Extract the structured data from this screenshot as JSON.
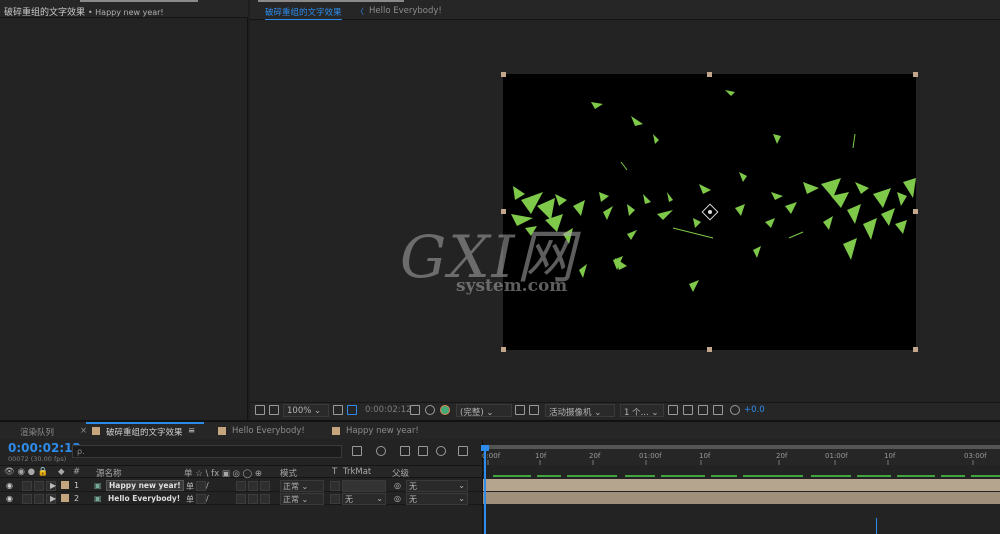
{
  "project_panel": {
    "tab_title": "破碎重组的文字效果",
    "tab_subtitle": "• Happy new year!"
  },
  "viewer": {
    "tabs": [
      "破碎重组的文字效果",
      "Hello Everybody!"
    ],
    "lock_glyph": "〈",
    "watermark_big": "GXI网",
    "watermark_small": "system.com",
    "toolbar": {
      "zoom": "100%",
      "timecode": "0:00:02:12",
      "resolution": "(完整)",
      "camera": "活动摄像机",
      "views": "1 个...",
      "exposure": "+0.0"
    }
  },
  "timeline": {
    "tabs": {
      "render_queue": "渲染队列",
      "close": "×",
      "comp": "破碎重组的文字效果",
      "menu": "≡",
      "comp2": "Hello Everybody!",
      "comp3": "Happy new year!"
    },
    "timecode": "0:00:02:12",
    "fps_text": "00072 (30.00 fps)",
    "search_placeholder": "ρ.",
    "headers": {
      "number": "#",
      "source_name": "源名称",
      "switches": "单 ☆ \\ fx ▣ ◎ ◯ ⊕",
      "mode": "模式",
      "t": "T",
      "trkmat": "TrkMat",
      "parent": "父级"
    },
    "layers": [
      {
        "num": "1",
        "name": "Happy new year!",
        "mode": "正常",
        "trkmat": "",
        "parent": "无"
      },
      {
        "num": "2",
        "name": "Hello Everybody!",
        "mode": "正常",
        "trkmat": "无",
        "parent": "无"
      }
    ],
    "ruler_ticks": [
      "0:00f",
      "10f",
      "20f",
      "01:00f",
      "10f",
      "20f",
      "01:00f",
      "10f",
      "03:00f"
    ]
  },
  "colors": {
    "accent": "#2d8ceb",
    "label_swatch": "#c5a57e",
    "particle_green": "#7ec84a"
  }
}
